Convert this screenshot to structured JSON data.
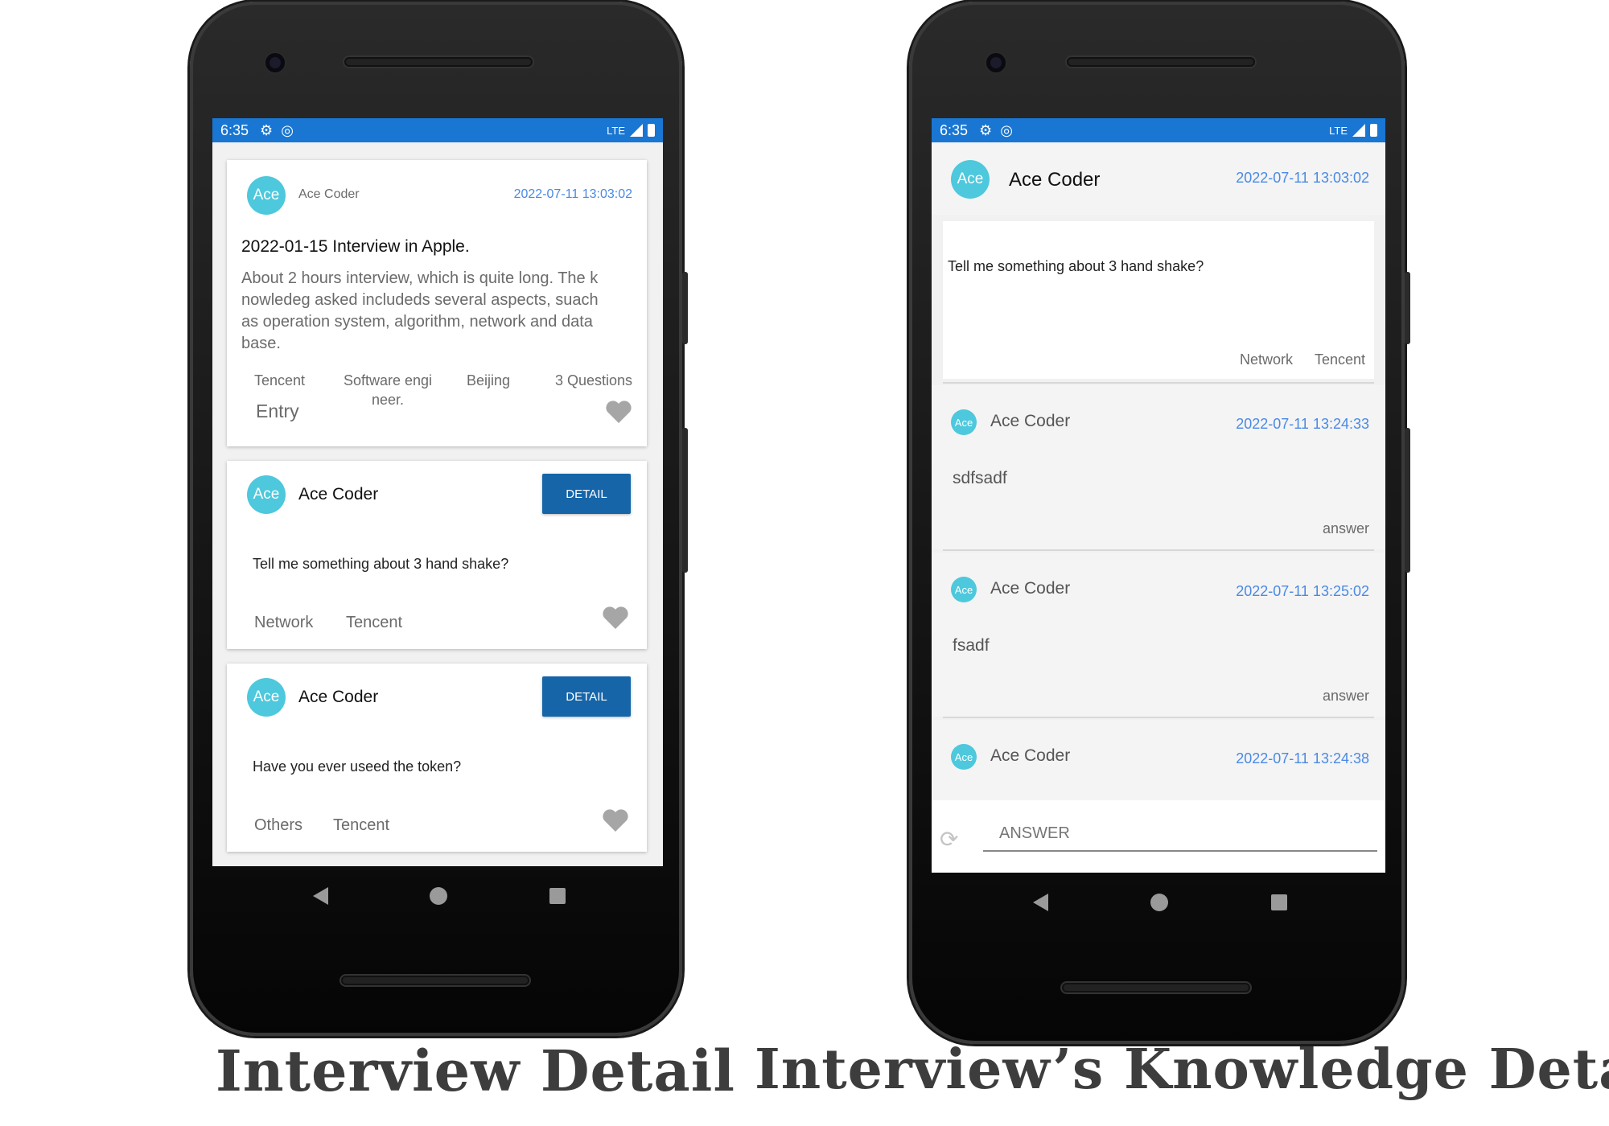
{
  "status_bar": {
    "time": "6:35",
    "network": "LTE"
  },
  "interview_detail": {
    "caption": "Interview Detail",
    "post": {
      "avatar": "Ace",
      "author": "Ace Coder",
      "date": "2022-07-11 13:03:02",
      "title": "2022-01-15 Interview in Apple.",
      "body_lines": [
        "About 2 hours interview, which is quite long. The k",
        "nowledeg asked includeds several aspects, suach",
        "as operation system, algorithm, network and data",
        "base."
      ],
      "company": "Tencent",
      "position_line1": "Software engi",
      "position_line2": "neer.",
      "city": "Beijing",
      "questions": "3 Questions",
      "level": "Entry"
    },
    "questions": [
      {
        "avatar": "Ace",
        "author": "Ace Coder",
        "button": "DETAIL",
        "text": "Tell me something about 3 hand shake?",
        "tag1": "Network",
        "tag2": "Tencent"
      },
      {
        "avatar": "Ace",
        "author": "Ace Coder",
        "button": "DETAIL",
        "text": "Have you ever useed the token?",
        "tag1": "Others",
        "tag2": "Tencent"
      }
    ]
  },
  "knowledge_detail": {
    "caption": "Interview’s Knowledge Detail",
    "header": {
      "avatar": "Ace",
      "author": "Ace Coder",
      "date": "2022-07-11 13:03:02"
    },
    "question": {
      "text": "Tell me something about 3 hand shake?",
      "tag1": "Network",
      "tag2": "Tencent"
    },
    "answers": [
      {
        "avatar": "Ace",
        "author": "Ace Coder",
        "date": "2022-07-11 13:24:33",
        "text": "sdfsadf",
        "label": "answer"
      },
      {
        "avatar": "Ace",
        "author": "Ace Coder",
        "date": "2022-07-11 13:25:02",
        "text": "fsadf",
        "label": "answer"
      },
      {
        "avatar": "Ace",
        "author": "Ace Coder",
        "date": "2022-07-11 13:24:38",
        "text": "",
        "label": ""
      }
    ],
    "answer_input_placeholder": "ANSWER"
  },
  "colors": {
    "status_bar": "#1976d2",
    "avatar": "#4dc8dc",
    "date": "#4a8ae4",
    "detail_button": "#1565a8"
  }
}
